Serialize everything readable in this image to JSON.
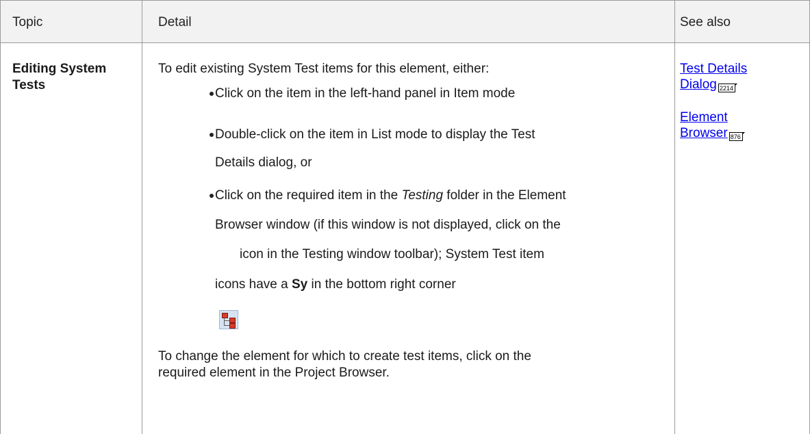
{
  "header": {
    "topic": "Topic",
    "detail": "Detail",
    "see_also": "See also"
  },
  "row": {
    "topic_line1": "Editing System",
    "topic_line2": "Tests",
    "intro": "To edit existing System Test items for this element, either:",
    "bullets": {
      "b1": "Click on the item in the left-hand panel in Item mode",
      "b2_line1": "Double-click on the item in List mode to display the Test",
      "b2_line2": "Details dialog, or",
      "b3_line1_a": "Click on the required item in the ",
      "b3_line1_em": "Testing",
      "b3_line1_b": " folder in the Element",
      "b3_line2": "Browser window (if this window is not displayed, click on the",
      "b3_line3": " icon in the Testing window toolbar); System Test item",
      "b3_line4_a": "icons have a ",
      "b3_line4_strong": "Sy",
      "b3_line4_b": " in the bottom right corner"
    },
    "outro_line1": "To change the element for which to create test items, click on the",
    "outro_line2": "required element in the Project Browser.",
    "icon": "element-browser-tree-icon"
  },
  "see_also": [
    {
      "line1": "Test Details",
      "line2": "Dialog",
      "page": "2214"
    },
    {
      "line1": "Element",
      "line2": "Browser",
      "page": "876"
    }
  ],
  "colors": {
    "link": "#0000ee",
    "header_bg": "#f2f2f2",
    "border": "#9a9a9a"
  }
}
